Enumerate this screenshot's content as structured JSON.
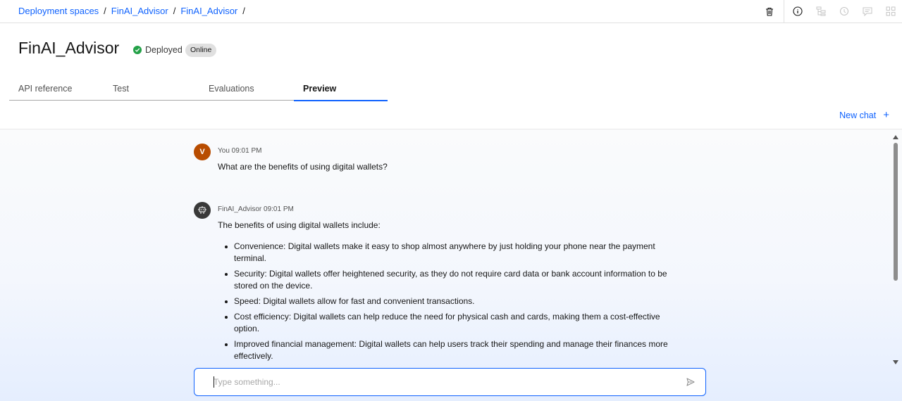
{
  "breadcrumb": {
    "items": [
      "Deployment spaces",
      "FinAI_Advisor",
      "FinAI_Advisor"
    ],
    "separator": "/"
  },
  "toolbar": {
    "icons": [
      "trash-icon",
      "info-icon",
      "hierarchy-icon",
      "history-icon",
      "comment-icon",
      "apps-icon"
    ]
  },
  "header": {
    "title": "FinAI_Advisor",
    "status": "Deployed",
    "badge": "Online"
  },
  "tabs": [
    {
      "label": "API reference",
      "active": false
    },
    {
      "label": "Test",
      "active": false
    },
    {
      "label": "Evaluations",
      "active": false
    },
    {
      "label": "Preview",
      "active": true
    }
  ],
  "new_chat": {
    "label": "New chat",
    "icon": "+"
  },
  "chat": {
    "messages": [
      {
        "avatar": "V",
        "meta": "You 09:01 PM",
        "text": "What are the benefits of using digital wallets?"
      },
      {
        "avatar": "bot-icon",
        "meta": "FinAI_Advisor 09:01 PM",
        "intro": "The benefits of using digital wallets include:",
        "bullets": [
          "Convenience: Digital wallets make it easy to shop almost anywhere by just holding your phone near the payment terminal.",
          "Security: Digital wallets offer heightened security, as they do not require card data or bank account information to be stored on the device.",
          "Speed: Digital wallets allow for fast and convenient transactions.",
          "Cost efficiency: Digital wallets can help reduce the need for physical cash and cards, making them a cost-effective option.",
          "Improved financial management: Digital wallets can help users track their spending and manage their finances more effectively."
        ]
      }
    ]
  },
  "input": {
    "placeholder": "Type something...",
    "value": ""
  },
  "colors": {
    "accent": "#0f62fe",
    "deployed": "#24a148",
    "user_avatar": "#b84c00",
    "bot_avatar": "#393939"
  }
}
